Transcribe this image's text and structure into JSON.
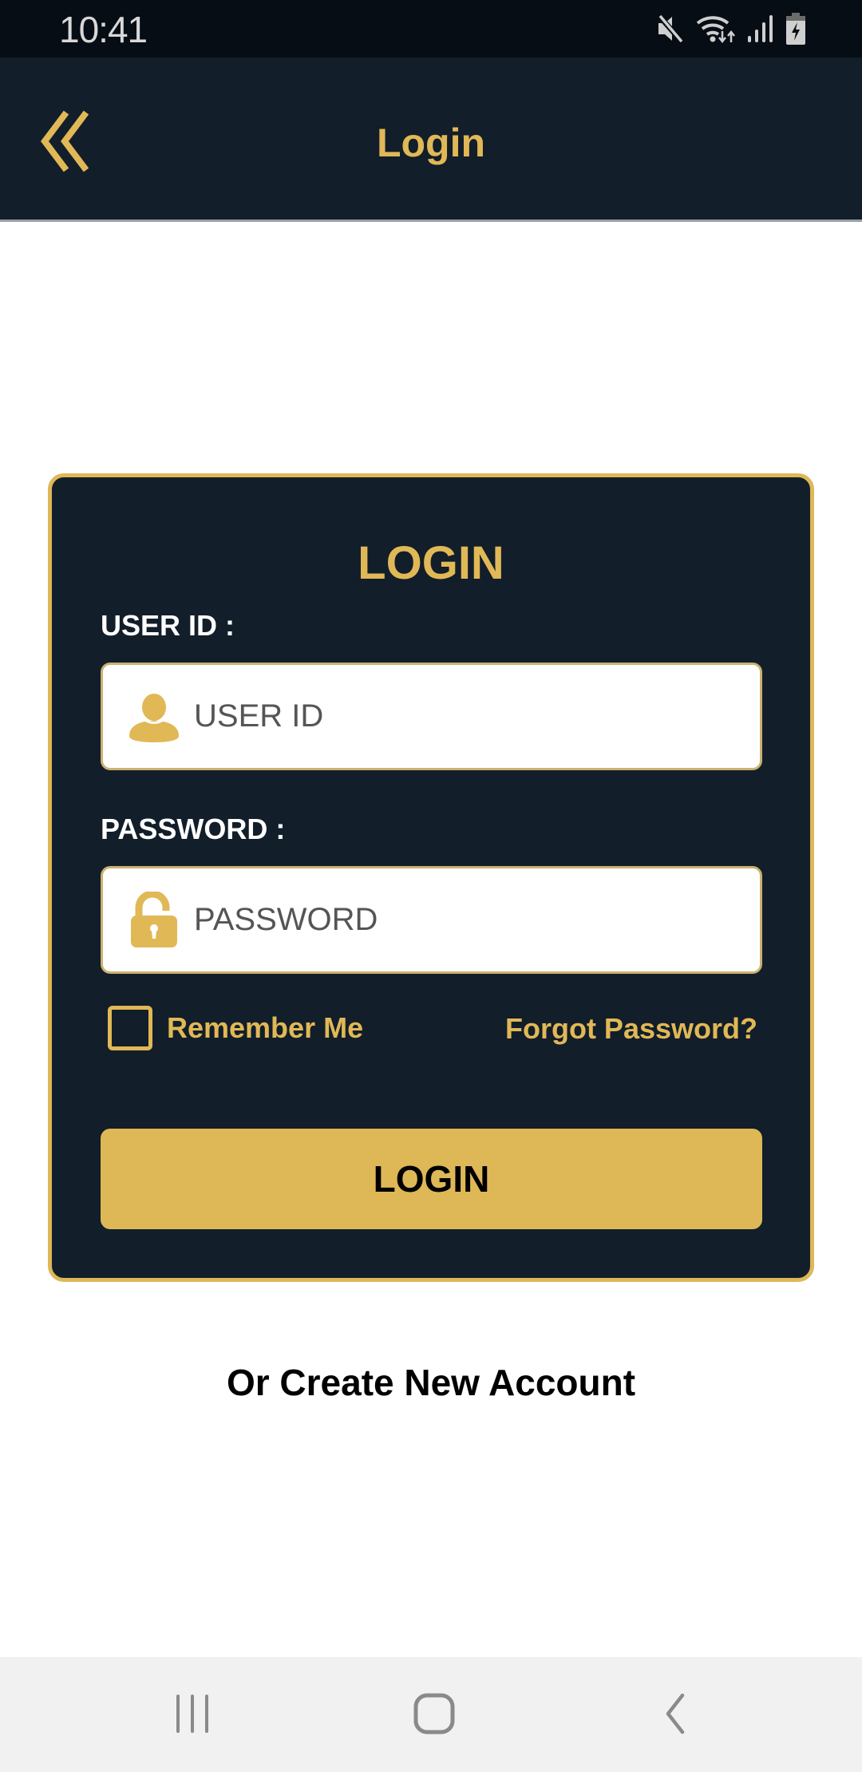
{
  "status_bar": {
    "time": "10:41",
    "icons": [
      "mute-icon",
      "wifi-icon",
      "signal-icon",
      "battery-charging-icon"
    ]
  },
  "app_bar": {
    "back_icon": "double-chevron-left-icon",
    "title": "Login"
  },
  "login_card": {
    "title": "LOGIN",
    "user_id": {
      "label": "USER ID :",
      "placeholder": "USER ID",
      "value": "",
      "icon": "user-icon"
    },
    "password": {
      "label": "PASSWORD :",
      "placeholder": "PASSWORD",
      "value": "",
      "icon": "unlocked-padlock-icon"
    },
    "remember_me": {
      "label": "Remember Me",
      "checked": false
    },
    "forgot_password": "Forgot Password?",
    "login_button": "LOGIN"
  },
  "create_account": "Or Create New Account",
  "nav_bar": {
    "buttons": [
      "recents-icon",
      "home-icon",
      "back-icon"
    ]
  },
  "colors": {
    "accent_gold": "#deb757",
    "dark_navy": "#121e2a",
    "status_bar": "#070d15",
    "nav_bar": "#f1f1f1"
  }
}
